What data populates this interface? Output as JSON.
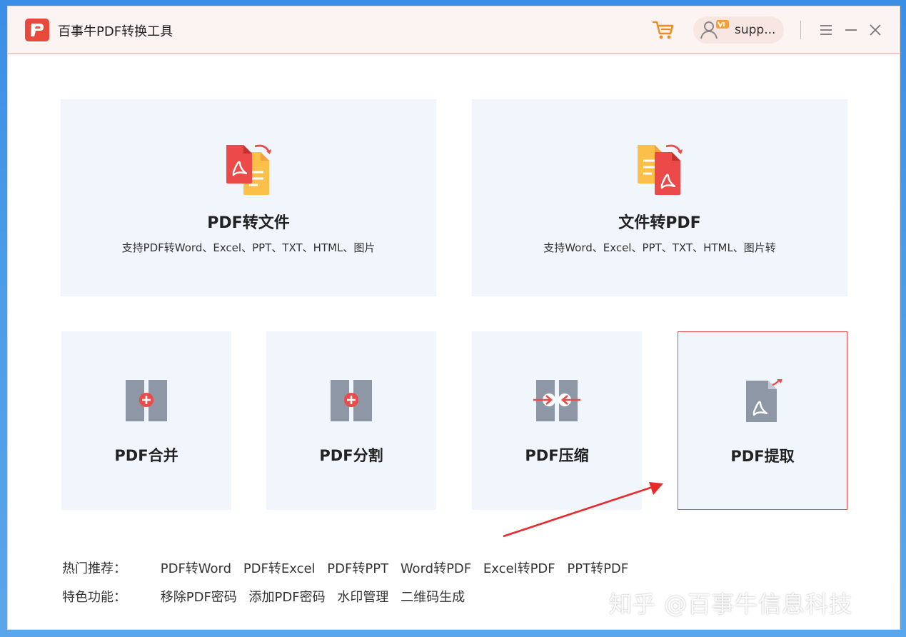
{
  "app": {
    "title": "百事牛PDF转换工具",
    "logo_letter": "P",
    "user_name": "supp..."
  },
  "colors": {
    "accent": "#e84a3c",
    "card_bg": "#f1f5fc",
    "icon_gray": "#8d97a6",
    "doc_yellow": "#fbbf4a",
    "selected_border": "#e84a4a"
  },
  "icons": {
    "cart": "shopping-cart-icon",
    "user": "user-vip-icon",
    "menu": "hamburger-menu-icon",
    "minimize": "minimize-icon",
    "close": "close-icon"
  },
  "cards": {
    "pdf_to_file": {
      "title": "PDF转文件",
      "subtitle": "支持PDF转Word、Excel、PPT、TXT、HTML、图片"
    },
    "file_to_pdf": {
      "title": "文件转PDF",
      "subtitle": "支持Word、Excel、PPT、TXT、HTML、图片转"
    },
    "merge": {
      "title": "PDF合并"
    },
    "split": {
      "title": "PDF分割"
    },
    "compress": {
      "title": "PDF压缩"
    },
    "extract": {
      "title": "PDF提取"
    }
  },
  "hot": {
    "label": "热门推荐：",
    "links": [
      "PDF转Word",
      "PDF转Excel",
      "PDF转PPT",
      "Word转PDF",
      "Excel转PDF",
      "PPT转PDF"
    ]
  },
  "features": {
    "label": "特色功能：",
    "links": [
      "移除PDF密码",
      "添加PDF密码",
      "水印管理",
      "二维码生成"
    ]
  },
  "watermark": "知乎 @百事牛信息科技"
}
